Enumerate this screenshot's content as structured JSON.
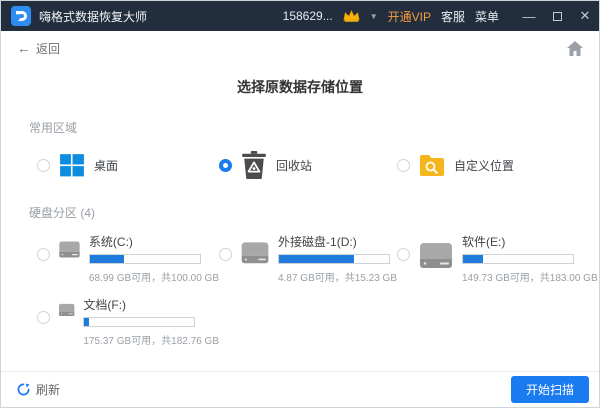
{
  "titlebar": {
    "app_name": "嗨格式数据恢复大师",
    "user_id": "158629...",
    "caret_glyph": "▼",
    "vip_label": "开通VIP",
    "support_label": "客服",
    "menu_label": "菜单",
    "minimize_glyph": "—",
    "close_glyph": "✕"
  },
  "nav": {
    "back_glyph": "←",
    "back_label": "返回"
  },
  "page": {
    "title": "选择原数据存储位置"
  },
  "common_area": {
    "section_label": "常用区域",
    "options": [
      {
        "label": "桌面",
        "icon": "windows-logo-icon",
        "selected": false
      },
      {
        "label": "回收站",
        "icon": "recycle-bin-icon",
        "selected": true
      },
      {
        "label": "自定义位置",
        "icon": "folder-search-icon",
        "selected": false
      }
    ]
  },
  "partitions": {
    "section_label": "硬盘分区 (4)",
    "disks": [
      {
        "name": "系统(C:)",
        "detail": "68.99 GB可用，共100.00 GB",
        "used_percent": 31
      },
      {
        "name": "外接磁盘-1(D:)",
        "detail": "4.87 GB可用，共15.23 GB",
        "used_percent": 68
      },
      {
        "name": "软件(E:)",
        "detail": "149.73 GB可用，共183.00 GB",
        "used_percent": 18
      },
      {
        "name": "文档(F:)",
        "detail": "175.37 GB可用，共182.76 GB",
        "used_percent": 4
      }
    ]
  },
  "footer": {
    "refresh_label": "刷新",
    "scan_label": "开始扫描"
  },
  "colors": {
    "titlebar_bg": "#222d3e",
    "accent_blue": "#1a7af0",
    "progress_blue": "#1f7bdc",
    "vip_orange": "#f59a3e",
    "crown_gold": "#f5b50a",
    "folder_yellow": "#f5b51c",
    "windows_blue": "#0d8ce0"
  }
}
